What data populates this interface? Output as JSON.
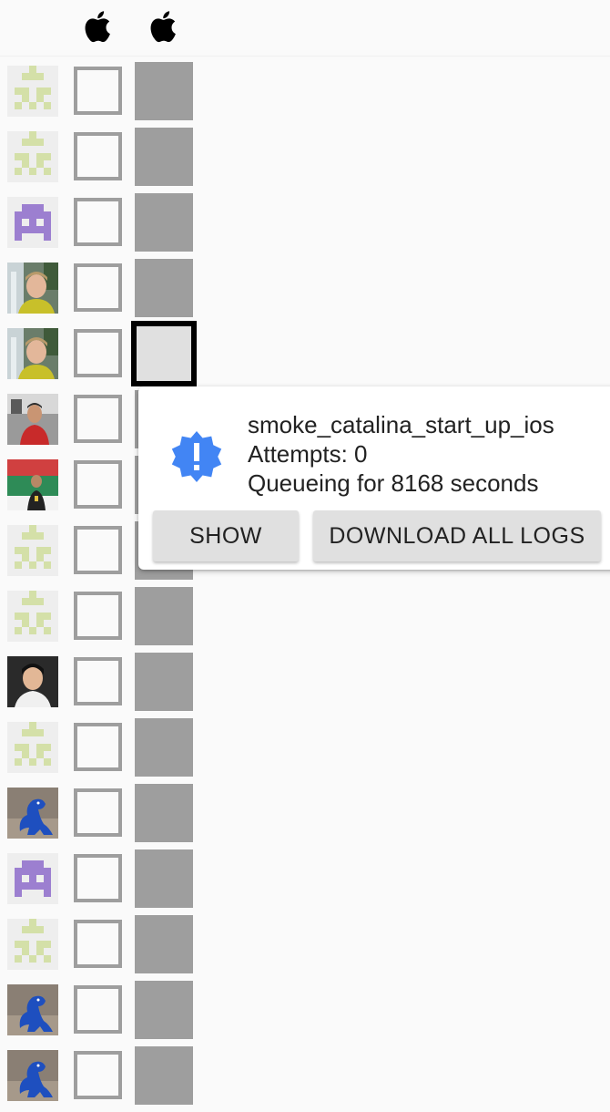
{
  "header": {
    "platform_icons": [
      "apple-icon",
      "apple-icon"
    ]
  },
  "rows": [
    {
      "avatar": "identicon-green",
      "cell": "queued"
    },
    {
      "avatar": "identicon-green",
      "cell": "queued"
    },
    {
      "avatar": "identicon-purple",
      "cell": "queued"
    },
    {
      "avatar": "photo-waterfall-person",
      "cell": "queued"
    },
    {
      "avatar": "photo-waterfall-person",
      "cell": "selected"
    },
    {
      "avatar": "photo-person-red-shirt",
      "cell": "queued"
    },
    {
      "avatar": "photo-person-banner",
      "cell": "queued"
    },
    {
      "avatar": "identicon-green",
      "cell": "queued"
    },
    {
      "avatar": "identicon-green",
      "cell": "queued"
    },
    {
      "avatar": "photo-person-portrait",
      "cell": "queued"
    },
    {
      "avatar": "identicon-green",
      "cell": "queued"
    },
    {
      "avatar": "photo-blue-dinosaur",
      "cell": "queued"
    },
    {
      "avatar": "identicon-purple",
      "cell": "queued"
    },
    {
      "avatar": "identicon-green",
      "cell": "queued"
    },
    {
      "avatar": "photo-blue-dinosaur",
      "cell": "queued"
    },
    {
      "avatar": "photo-blue-dinosaur",
      "cell": "queued"
    }
  ],
  "popup": {
    "icon": "alert-badge-icon",
    "task_name": "smoke_catalina_start_up_ios",
    "attempts": "Attempts: 0",
    "queue_status": "Queueing for 8168 seconds",
    "show_label": "SHOW",
    "download_label": "DOWNLOAD ALL LOGS"
  },
  "colors": {
    "background": "#fafafa",
    "cell_queued": "#9e9e9e",
    "cell_selected": "#e0e0e0",
    "alert_blue": "#4285f4",
    "identicon_green": "#d4e0a8",
    "identicon_purple": "#9c7fd0"
  }
}
